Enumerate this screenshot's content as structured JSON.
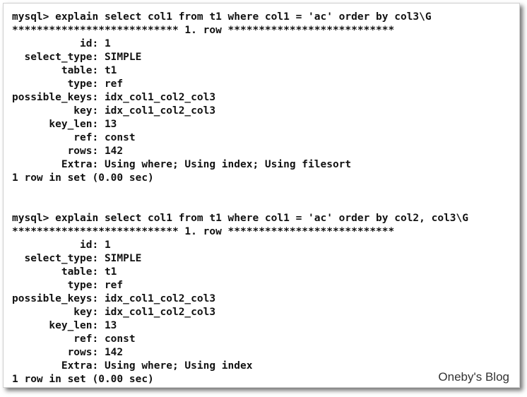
{
  "blocks": [
    {
      "lines": [
        "mysql> explain select col1 from t1 where col1 = 'ac' order by col3\\G",
        "*************************** 1. row ***************************",
        "           id: 1",
        "  select_type: SIMPLE",
        "        table: t1",
        "         type: ref",
        "possible_keys: idx_col1_col2_col3",
        "          key: idx_col1_col2_col3",
        "      key_len: 13",
        "          ref: const",
        "         rows: 142",
        "        Extra: Using where; Using index; Using filesort",
        "1 row in set (0.00 sec)"
      ]
    },
    {
      "lines": [
        "mysql> explain select col1 from t1 where col1 = 'ac' order by col2, col3\\G",
        "*************************** 1. row ***************************",
        "           id: 1",
        "  select_type: SIMPLE",
        "        table: t1",
        "         type: ref",
        "possible_keys: idx_col1_col2_col3",
        "          key: idx_col1_col2_col3",
        "      key_len: 13",
        "          ref: const",
        "         rows: 142",
        "        Extra: Using where; Using index",
        "1 row in set (0.00 sec)"
      ]
    }
  ],
  "watermark": "Oneby's Blog"
}
